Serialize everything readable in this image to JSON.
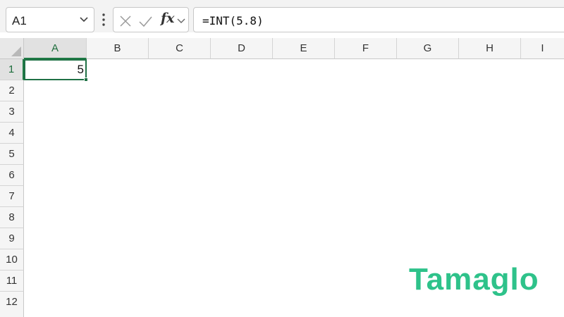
{
  "name_box": {
    "value": "A1"
  },
  "formula_bar": {
    "cancel_icon": "x-icon",
    "enter_icon": "check-icon",
    "fx_label": "fx",
    "formula": "=INT(5.8)"
  },
  "columns": [
    "A",
    "B",
    "C",
    "D",
    "E",
    "F",
    "G",
    "H",
    "I"
  ],
  "rows": [
    "1",
    "2",
    "3",
    "4",
    "5",
    "6",
    "7",
    "8",
    "9",
    "10",
    "11",
    "12"
  ],
  "selected_cell": {
    "column": "A",
    "row": "1"
  },
  "cells": {
    "A1": "5"
  },
  "watermark": "Tamaglo",
  "colors": {
    "accent": "#1f7145",
    "watermark": "#2ec28a"
  }
}
